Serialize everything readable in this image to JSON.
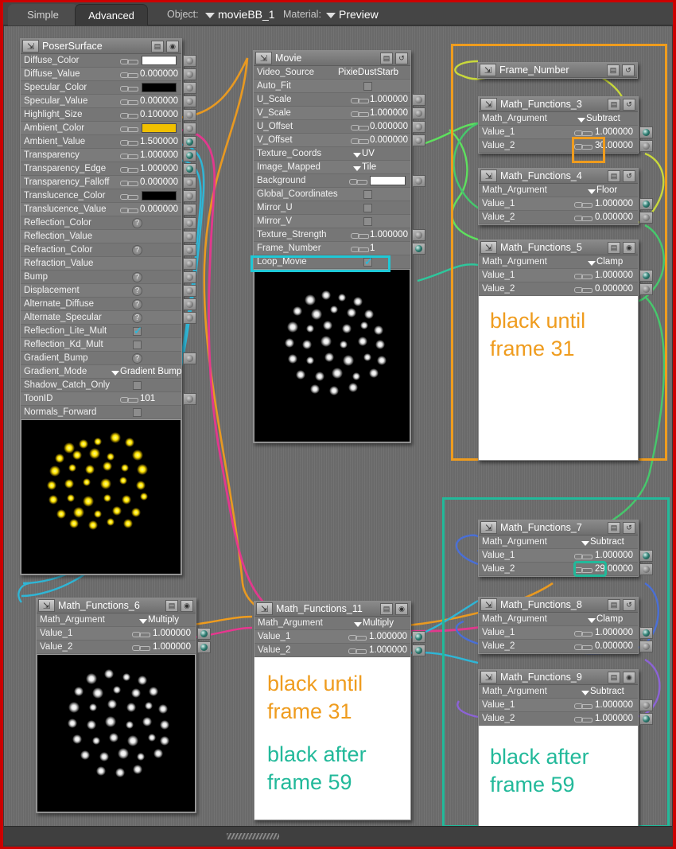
{
  "window": {
    "border_color": "#cc0000"
  },
  "topbar": {
    "tabs": [
      {
        "label": "Simple",
        "active": false
      },
      {
        "label": "Advanced",
        "active": true
      }
    ],
    "object_label": "Object:",
    "object_value": "movieBB_1",
    "material_label": "Material:",
    "material_value": "Preview"
  },
  "colors": {
    "orange": "#ef9c1e",
    "teal": "#22b99a",
    "cyan": "#2fb6d6",
    "pink": "#e8368f",
    "green": "#39c46b",
    "yellow_wire": "#c9d93b",
    "ambient": "#f0c000"
  },
  "nodes": {
    "poser_surface": {
      "title": "PoserSurface",
      "rows": [
        {
          "label": "Diffuse_Color",
          "type": "swatch",
          "value": "#ffffff"
        },
        {
          "label": "Diffuse_Value",
          "type": "number",
          "value": "0.000000"
        },
        {
          "label": "Specular_Color",
          "type": "swatch",
          "value": "#000000"
        },
        {
          "label": "Specular_Value",
          "type": "number",
          "value": "0.000000"
        },
        {
          "label": "Highlight_Size",
          "type": "number",
          "value": "0.100000"
        },
        {
          "label": "Ambient_Color",
          "type": "swatch",
          "value": "#f0c000"
        },
        {
          "label": "Ambient_Value",
          "type": "number",
          "value": "1.500000"
        },
        {
          "label": "Transparency",
          "type": "number",
          "value": "1.000000"
        },
        {
          "label": "Transparency_Edge",
          "type": "number",
          "value": "1.000000"
        },
        {
          "label": "Transparency_Falloff",
          "type": "number",
          "value": "0.000000"
        },
        {
          "label": "Translucence_Color",
          "type": "swatch",
          "value": "#000000"
        },
        {
          "label": "Translucence_Value",
          "type": "number",
          "value": "0.000000"
        },
        {
          "label": "Reflection_Color",
          "type": "question",
          "value": "?"
        },
        {
          "label": "Reflection_Value",
          "type": "empty",
          "value": ""
        },
        {
          "label": "Refraction_Color",
          "type": "question",
          "value": "?"
        },
        {
          "label": "Refraction_Value",
          "type": "empty",
          "value": ""
        },
        {
          "label": "Bump",
          "type": "question",
          "value": "?"
        },
        {
          "label": "Displacement",
          "type": "question",
          "value": "?"
        },
        {
          "label": "Alternate_Diffuse",
          "type": "question",
          "value": "?"
        },
        {
          "label": "Alternate_Specular",
          "type": "question",
          "value": "?"
        },
        {
          "label": "Reflection_Lite_Mult",
          "type": "check_on",
          "value": ""
        },
        {
          "label": "Reflection_Kd_Mult",
          "type": "check_off",
          "value": ""
        },
        {
          "label": "Gradient_Bump",
          "type": "question",
          "value": "?"
        },
        {
          "label": "Gradient_Mode",
          "type": "dropdown",
          "value": "Gradient Bump"
        },
        {
          "label": "Shadow_Catch_Only",
          "type": "check_off",
          "value": ""
        },
        {
          "label": "ToonID",
          "type": "number",
          "value": "101"
        },
        {
          "label": "Normals_Forward",
          "type": "check_off",
          "value": ""
        }
      ],
      "preview_alt": "yellow sparkle particle sphere"
    },
    "movie": {
      "title": "Movie",
      "rows": [
        {
          "label": "Video_Source",
          "type": "text",
          "value": "PixieDustStarb"
        },
        {
          "label": "Auto_Fit",
          "type": "check_off",
          "value": ""
        },
        {
          "label": "U_Scale",
          "type": "number",
          "value": "1.000000"
        },
        {
          "label": "V_Scale",
          "type": "number",
          "value": "1.000000"
        },
        {
          "label": "U_Offset",
          "type": "number",
          "value": "0.000000"
        },
        {
          "label": "V_Offset",
          "type": "number",
          "value": "0.000000"
        },
        {
          "label": "Texture_Coords",
          "type": "dropdown",
          "value": "UV"
        },
        {
          "label": "Image_Mapped",
          "type": "dropdown",
          "value": "Tile"
        },
        {
          "label": "Background",
          "type": "swatch",
          "value": "#ffffff"
        },
        {
          "label": "Global_Coordinates",
          "type": "check_off",
          "value": ""
        },
        {
          "label": "Mirror_U",
          "type": "check_off",
          "value": ""
        },
        {
          "label": "Mirror_V",
          "type": "check_off",
          "value": ""
        },
        {
          "label": "Texture_Strength",
          "type": "number",
          "value": "1.000000"
        },
        {
          "label": "Frame_Number",
          "type": "number",
          "value": "1"
        },
        {
          "label": "Loop_Movie",
          "type": "check_on",
          "value": ""
        }
      ],
      "highlight_row": "Loop_Movie",
      "highlight_color": "#1fc8d6",
      "preview_alt": "white sparkle particle sphere"
    },
    "frame_number": {
      "title": "Frame_Number",
      "rows": []
    },
    "math_functions_3": {
      "title": "Math_Functions_3",
      "rows": [
        {
          "label": "Math_Argument",
          "type": "dropdown",
          "value": "Subtract"
        },
        {
          "label": "Value_1",
          "type": "number",
          "value": "1.000000"
        },
        {
          "label": "Value_2",
          "type": "number",
          "value": "30.00000"
        }
      ],
      "highlight_value": "30.00000",
      "highlight_color": "#ef9c1e"
    },
    "math_functions_4": {
      "title": "Math_Functions_4",
      "rows": [
        {
          "label": "Math_Argument",
          "type": "dropdown",
          "value": "Floor"
        },
        {
          "label": "Value_1",
          "type": "number",
          "value": "1.000000"
        },
        {
          "label": "Value_2",
          "type": "number",
          "value": "0.000000"
        }
      ]
    },
    "math_functions_5": {
      "title": "Math_Functions_5",
      "rows": [
        {
          "label": "Math_Argument",
          "type": "dropdown",
          "value": "Clamp"
        },
        {
          "label": "Value_1",
          "type": "number",
          "value": "1.000000"
        },
        {
          "label": "Value_2",
          "type": "number",
          "value": "0.000000"
        }
      ],
      "note": {
        "lines": [
          "black until",
          "frame 31"
        ],
        "color": "#ef9c1e"
      }
    },
    "math_functions_6": {
      "title": "Math_Functions_6",
      "rows": [
        {
          "label": "Math_Argument",
          "type": "dropdown",
          "value": "Multiply"
        },
        {
          "label": "Value_1",
          "type": "number",
          "value": "1.000000"
        },
        {
          "label": "Value_2",
          "type": "number",
          "value": "1.000000"
        }
      ],
      "preview_alt": "white sparkle particle sphere"
    },
    "math_functions_11": {
      "title": "Math_Functions_11",
      "rows": [
        {
          "label": "Math_Argument",
          "type": "dropdown",
          "value": "Multiply"
        },
        {
          "label": "Value_1",
          "type": "number",
          "value": "1.000000"
        },
        {
          "label": "Value_2",
          "type": "number",
          "value": "1.000000"
        }
      ],
      "note": {
        "lines": [
          "black until",
          "frame 31",
          "",
          "black after",
          "frame 59"
        ],
        "color_1": "#ef9c1e",
        "color_2": "#22b99a"
      }
    },
    "math_functions_7": {
      "title": "Math_Functions_7",
      "rows": [
        {
          "label": "Math_Argument",
          "type": "dropdown",
          "value": "Subtract"
        },
        {
          "label": "Value_1",
          "type": "number",
          "value": "1.000000"
        },
        {
          "label": "Value_2",
          "type": "number",
          "value": "29.00000"
        }
      ],
      "highlight_value": "29.00000",
      "highlight_color": "#22b99a"
    },
    "math_functions_8": {
      "title": "Math_Functions_8",
      "rows": [
        {
          "label": "Math_Argument",
          "type": "dropdown",
          "value": "Clamp"
        },
        {
          "label": "Value_1",
          "type": "number",
          "value": "1.000000"
        },
        {
          "label": "Value_2",
          "type": "number",
          "value": "0.000000"
        }
      ]
    },
    "math_functions_9": {
      "title": "Math_Functions_9",
      "rows": [
        {
          "label": "Math_Argument",
          "type": "dropdown",
          "value": "Subtract"
        },
        {
          "label": "Value_1",
          "type": "number",
          "value": "1.000000"
        },
        {
          "label": "Value_2",
          "type": "number",
          "value": "1.000000"
        }
      ],
      "note": {
        "lines": [
          "black after",
          "frame 59"
        ],
        "color": "#22b99a"
      }
    }
  },
  "groups": [
    {
      "name": "black-until-frame-31-group",
      "color": "#ef9c1e"
    },
    {
      "name": "black-after-frame-59-group",
      "color": "#22b99a"
    }
  ],
  "icons": {
    "node_icon": "⇲",
    "list_icon": "▤",
    "eye_icon": "◉",
    "refresh_icon": "↺",
    "question_icon": "?",
    "check_icon": "✓"
  }
}
